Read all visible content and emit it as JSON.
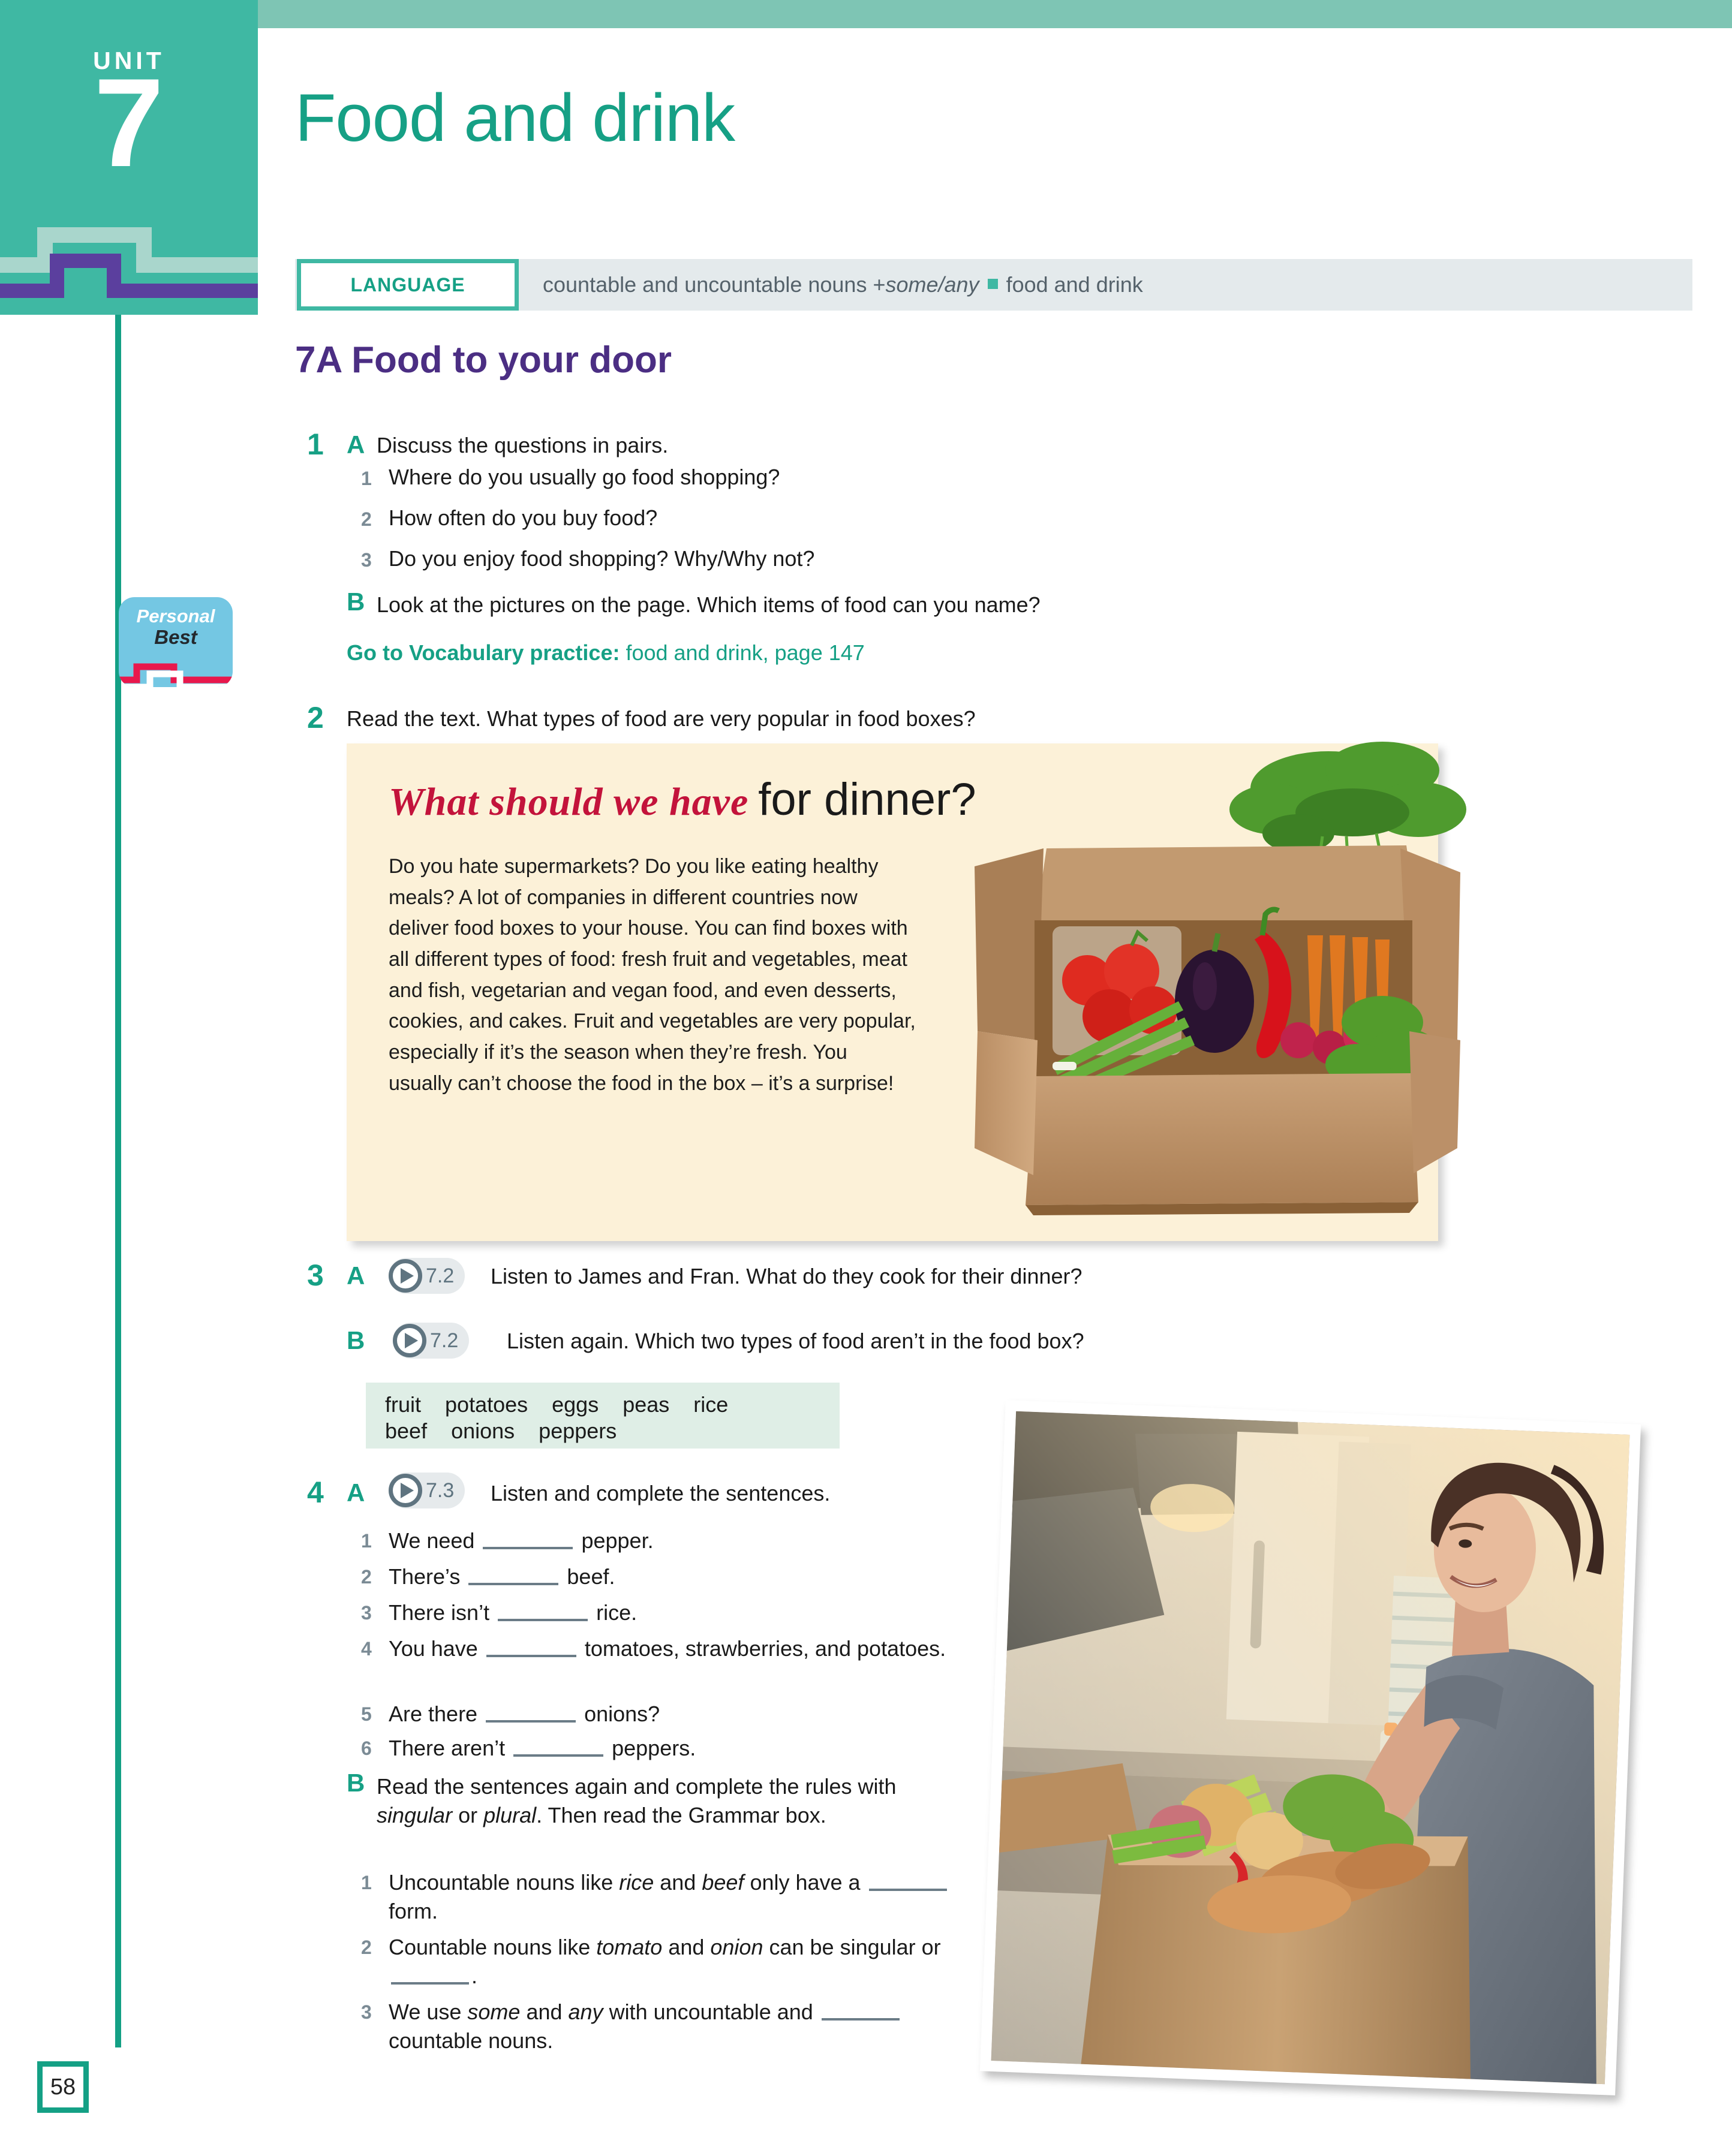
{
  "page": {
    "number": "58",
    "unit_label": "UNIT",
    "unit_number": "7",
    "title": "Food and drink"
  },
  "language_bar": {
    "tag": "LANGUAGE",
    "part1": "countable and uncountable nouns + ",
    "italic": "some/any",
    "part2": "food and drink"
  },
  "section": {
    "heading": "7A  Food to your door"
  },
  "personal_best": {
    "line1": "Personal",
    "line2": "Best"
  },
  "ex1": {
    "number": "1",
    "a_letter": "A",
    "a_text": "Discuss the questions in pairs.",
    "questions": [
      {
        "n": "1",
        "t": "Where do you usually go food shopping?"
      },
      {
        "n": "2",
        "t": "How often do you buy food?"
      },
      {
        "n": "3",
        "t": "Do you enjoy food shopping? Why/Why not?"
      }
    ],
    "b_letter": "B",
    "b_text": "Look at the pictures on the page. Which items of food can you name?",
    "vocab_bold": "Go to Vocabulary practice:",
    "vocab_rest": " food and drink, page 147"
  },
  "ex2": {
    "number": "2",
    "text": "Read the text. What types of food are very popular in food boxes?",
    "article": {
      "headline_cursive": "What should we have",
      "headline_plain": "for dinner?",
      "body": "Do you hate supermarkets? Do you like eating healthy meals? A lot of companies in different countries now deliver food boxes to your house. You can find boxes with all different types of food: fresh fruit and vegetables, meat and fish, vegetarian and vegan food, and even desserts, cookies, and cakes. Fruit and vegetables are very popular, especially if it’s the season when they’re fresh. You usually can’t choose the food in the box – it’s a surprise!"
    }
  },
  "ex3": {
    "number": "3",
    "a_letter": "A",
    "a_audio": "7.2",
    "a_text": "Listen to James and Fran. What do they cook for their dinner?",
    "b_letter": "B",
    "b_audio": "7.2",
    "b_text": "Listen again. Which two types of food aren’t in the food box?",
    "word_box_line1": "fruit    potatoes    eggs    peas    rice",
    "word_box_line2": "beef    onions    peppers"
  },
  "ex4": {
    "number": "4",
    "a_letter": "A",
    "a_audio": "7.3",
    "a_text": "Listen and complete the sentences.",
    "sentences": [
      {
        "n": "1",
        "pre": "We need ",
        "post": " pepper."
      },
      {
        "n": "2",
        "pre": "There’s ",
        "post": " beef."
      },
      {
        "n": "3",
        "pre": "There isn’t ",
        "post": " rice."
      },
      {
        "n": "4",
        "pre": "You have ",
        "post": " tomatoes, strawberries, and potatoes."
      },
      {
        "n": "5",
        "pre": "Are there ",
        "post": " onions?"
      },
      {
        "n": "6",
        "pre": "There aren’t ",
        "post": " peppers."
      }
    ],
    "b_letter": "B",
    "b_text_1": "Read the sentences again and complete the rules with ",
    "b_italic_1": "singular",
    "b_text_2": " or ",
    "b_italic_2": "plural",
    "b_text_3": ". Then read the Grammar box.",
    "rules": [
      {
        "n": "1",
        "p1": "Uncountable nouns like ",
        "i1": "rice",
        "p2": " and ",
        "i2": "beef",
        "p3": " only have a ",
        "p4": " form."
      },
      {
        "n": "2",
        "p1": "Countable nouns like ",
        "i1": "tomato",
        "p2": " and ",
        "i2": "onion",
        "p3": " can be singular or ",
        "p4": "."
      },
      {
        "n": "3",
        "p1": "We use ",
        "i1": "some",
        "p2": " and ",
        "i2": "any",
        "p3": " with uncountable and ",
        "p4": " countable nouns."
      }
    ]
  },
  "colors": {
    "teal": "#16a085",
    "teal_light": "#3fb8a3",
    "teal_pale": "#7ec5b4",
    "purple": "#4b2e83",
    "cream": "#fcf1d8",
    "mint": "#dfeee6",
    "grey_bar": "#e4eaec",
    "badge_blue": "#74c7e3",
    "badge_red": "#e8184c"
  }
}
